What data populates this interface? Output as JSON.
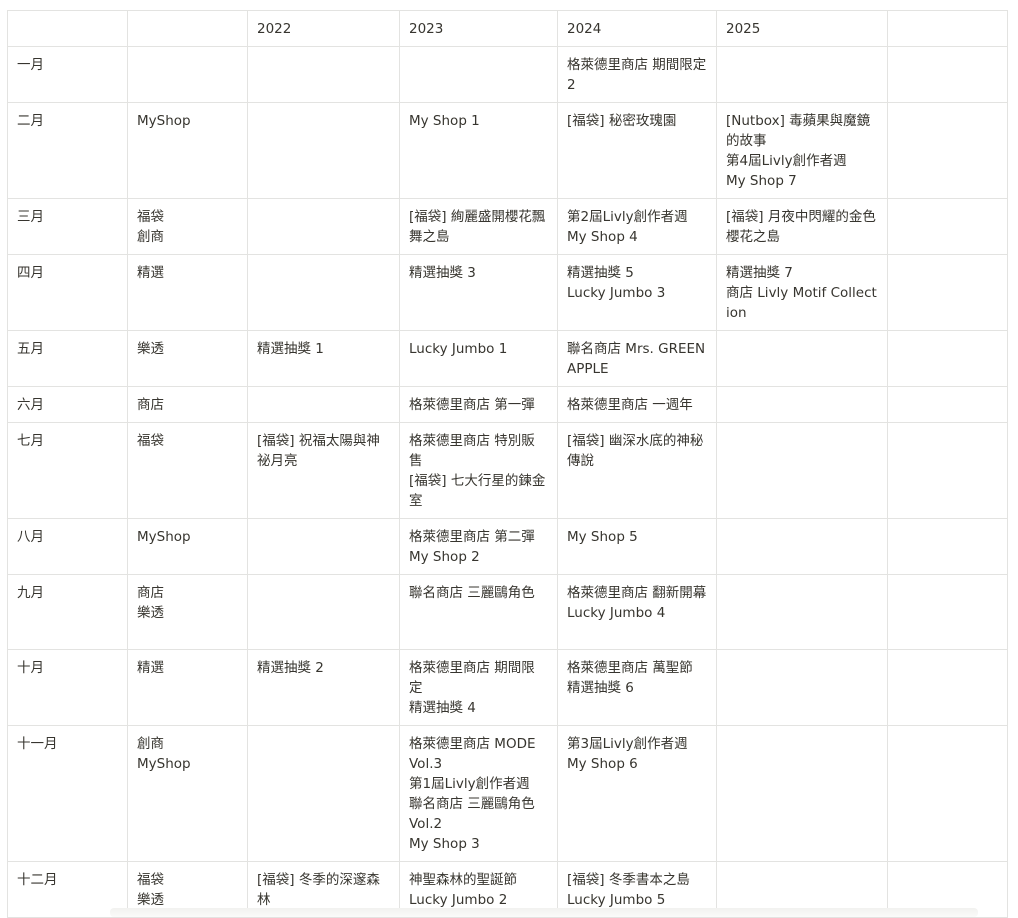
{
  "table": {
    "header": [
      "",
      "",
      "2022",
      "2023",
      "2024",
      "2025",
      ""
    ],
    "rows": [
      [
        "一月",
        "",
        "",
        "",
        "格萊德里商店 期間限定2",
        "",
        ""
      ],
      [
        "二月",
        "MyShop",
        "",
        "My Shop 1",
        "[福袋] 秘密玫瑰園",
        "[Nutbox] 毒蘋果與魔鏡的故事\n第4屆Livly創作者週\nMy Shop 7",
        ""
      ],
      [
        "三月",
        "福袋\n創商",
        "",
        "[福袋] 絢麗盛開櫻花飄舞之島",
        "第2屆Livly創作者週\nMy Shop 4",
        "[福袋] 月夜中閃耀的金色櫻花之島",
        ""
      ],
      [
        "四月",
        "精選",
        "",
        "精選抽獎 3",
        "精選抽獎 5\nLucky Jumbo 3",
        "精選抽獎 7\n商店 Livly Motif Collection",
        ""
      ],
      [
        "五月",
        "樂透",
        "精選抽獎 1",
        "Lucky Jumbo 1",
        "聯名商店 Mrs. GREEN APPLE",
        "",
        ""
      ],
      [
        "六月",
        "商店",
        "",
        "格萊德里商店 第一彈",
        "格萊德里商店 一週年",
        "",
        ""
      ],
      [
        "七月",
        "福袋",
        "[福袋] 祝福太陽與神祕月亮",
        "格萊德里商店 特別販售\n[福袋] 七大行星的鍊金室",
        "[福袋] 幽深水底的神秘傳說",
        "",
        ""
      ],
      [
        "八月",
        "MyShop",
        "",
        "格萊德里商店 第二彈\nMy Shop 2",
        "My Shop 5",
        "",
        ""
      ],
      [
        "九月",
        "商店\n樂透",
        "",
        "聯名商店 三麗鷗角色",
        "格萊德里商店 翻新開幕\nLucky Jumbo 4",
        "",
        ""
      ],
      [
        "十月",
        "精選",
        "精選抽獎 2",
        "格萊德里商店 期間限定\n精選抽獎 4",
        "格萊德里商店 萬聖節\n精選抽獎 6",
        "",
        ""
      ],
      [
        "十一月",
        "創商\nMyShop",
        "",
        "格萊德里商店 MODE Vol.3\n第1屆Livly創作者週\n聯名商店 三麗鷗角色 Vol.2\nMy Shop 3",
        "第3屆Livly創作者週\nMy Shop 6",
        "",
        ""
      ],
      [
        "十二月",
        "福袋\n樂透",
        "[福袋] 冬季的深邃森林",
        "神聖森林的聖誕節\nLucky Jumbo 2",
        "[福袋] 冬季書本之島\nLucky Jumbo 5",
        "",
        ""
      ]
    ]
  }
}
